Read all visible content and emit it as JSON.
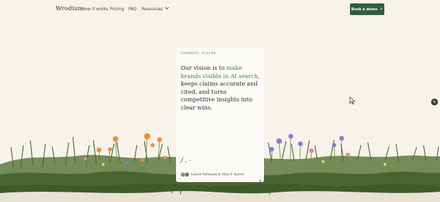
{
  "nav": {
    "logo": "Wrodium",
    "links": [
      "How it works",
      "Pricing",
      "FAQ",
      "Resources"
    ],
    "cta_label": "Book a demo",
    "cta_icon": "arrow-up-right-icon"
  },
  "card": {
    "eyebrow": "FOUNDERS VISION",
    "quote_before": "Our vision is to ",
    "quote_accent": "make brands visible in AI search",
    "quote_after": ", keeps claims accurate and cited, and turns competitive insights into clear wins.",
    "signature": "/ . ·",
    "authors": "Leanid Palhouski & Allen F. Kumar"
  },
  "colors": {
    "background": "#f7f3ea",
    "accent": "#3e7f5c",
    "cta": "#2f5d41",
    "grass": "#4f6b35"
  }
}
